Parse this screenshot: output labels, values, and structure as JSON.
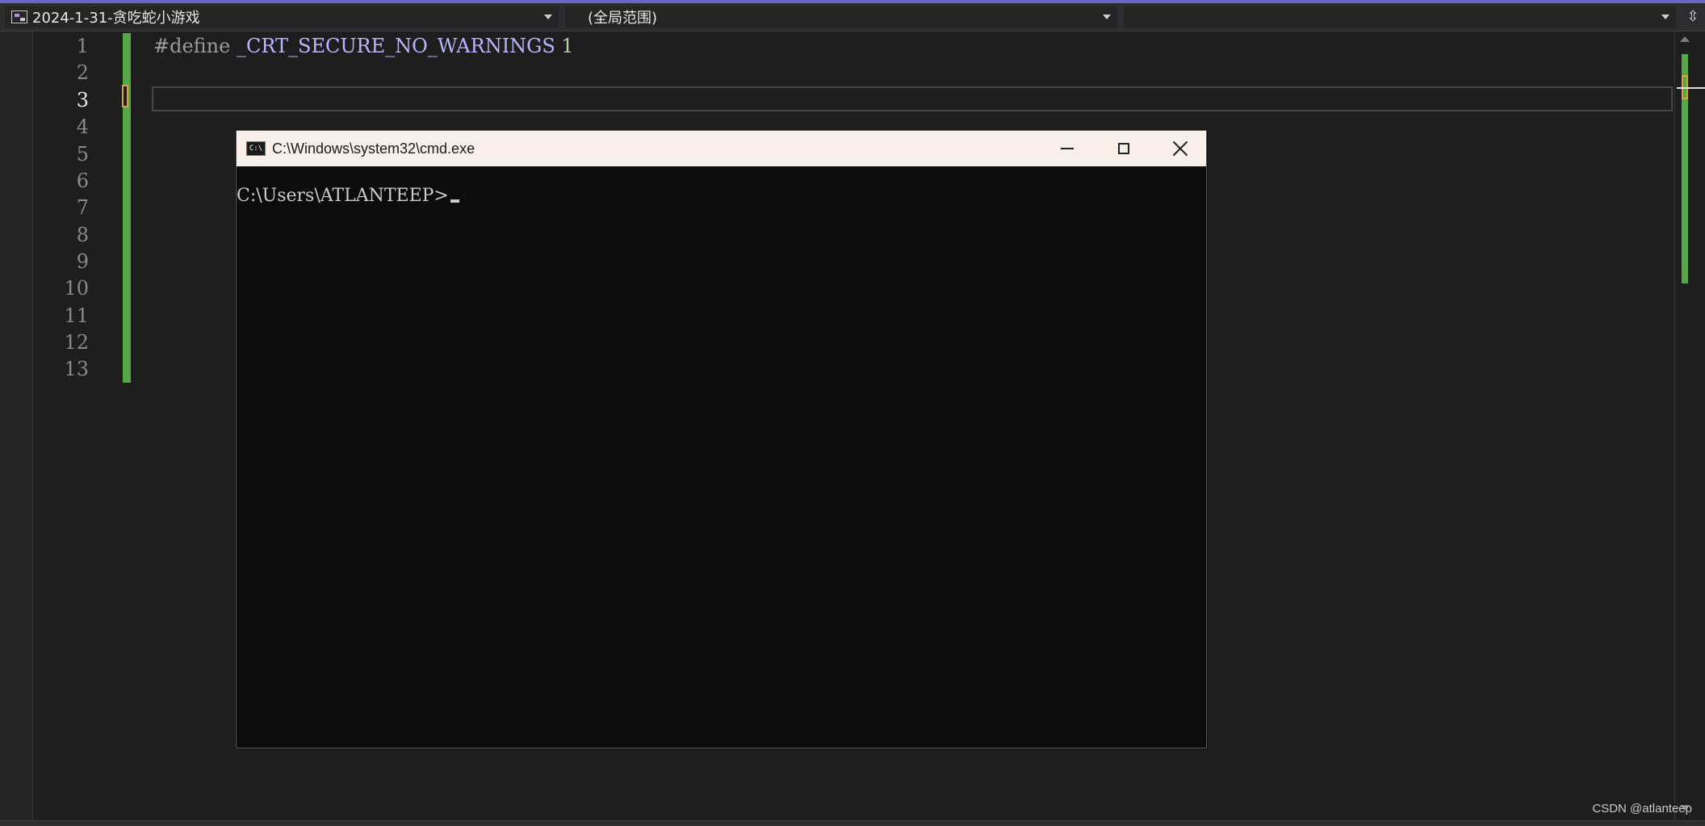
{
  "navbar": {
    "project": "2024-1-31-贪吃蛇小游戏",
    "scope": "(全局范围)",
    "member": ""
  },
  "editor": {
    "line_numbers": [
      "1",
      "2",
      "3",
      "4",
      "5",
      "6",
      "7",
      "8",
      "9",
      "10",
      "11",
      "12",
      "13"
    ],
    "active_line": "3",
    "code": {
      "directive": "#define ",
      "macro": "_CRT_SECURE_NO_WARNINGS",
      "value": " 1"
    }
  },
  "cmd": {
    "title": "C:\\Windows\\system32\\cmd.exe",
    "icon_text": "C:\\",
    "prompt": "C:\\Users\\ATLANTEEP>"
  },
  "watermark": "CSDN @atlanteep",
  "colors": {
    "accent": "#6c63c8",
    "change_bar": "#57a64a",
    "caret_marker": "#d7a43b",
    "macro": "#bdb4ff"
  }
}
